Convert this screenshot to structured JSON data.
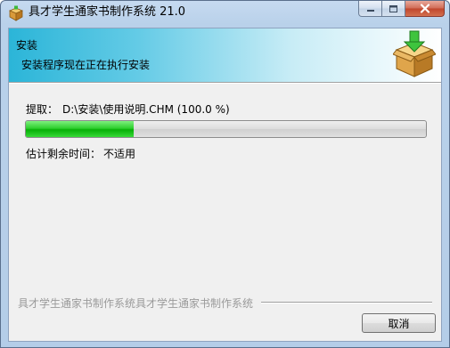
{
  "window": {
    "title": "具才学生通家书制作系统 21.0",
    "caption_buttons": {
      "minimize_icon": "minimize-icon",
      "maximize_icon": "maximize-icon",
      "close_icon": "close-icon"
    }
  },
  "header": {
    "title": "安装",
    "subtitle": "安装程序现在正在执行安装",
    "icon": "package-install-icon"
  },
  "progress": {
    "extract_label": "提取：",
    "extract_path": "D:\\安装\\使用说明.CHM (100.0 %)",
    "fill_fraction": 0.27,
    "remaining_label": "估计剩余时间：",
    "remaining_value": "不适用"
  },
  "footer": {
    "brand_text": "具才学生通家书制作系统具才学生通家书制作系统",
    "cancel_label": "取消"
  },
  "colors": {
    "progress_green": "#06b006",
    "header_start": "#2bb5d8",
    "close_red": "#c0452c"
  }
}
